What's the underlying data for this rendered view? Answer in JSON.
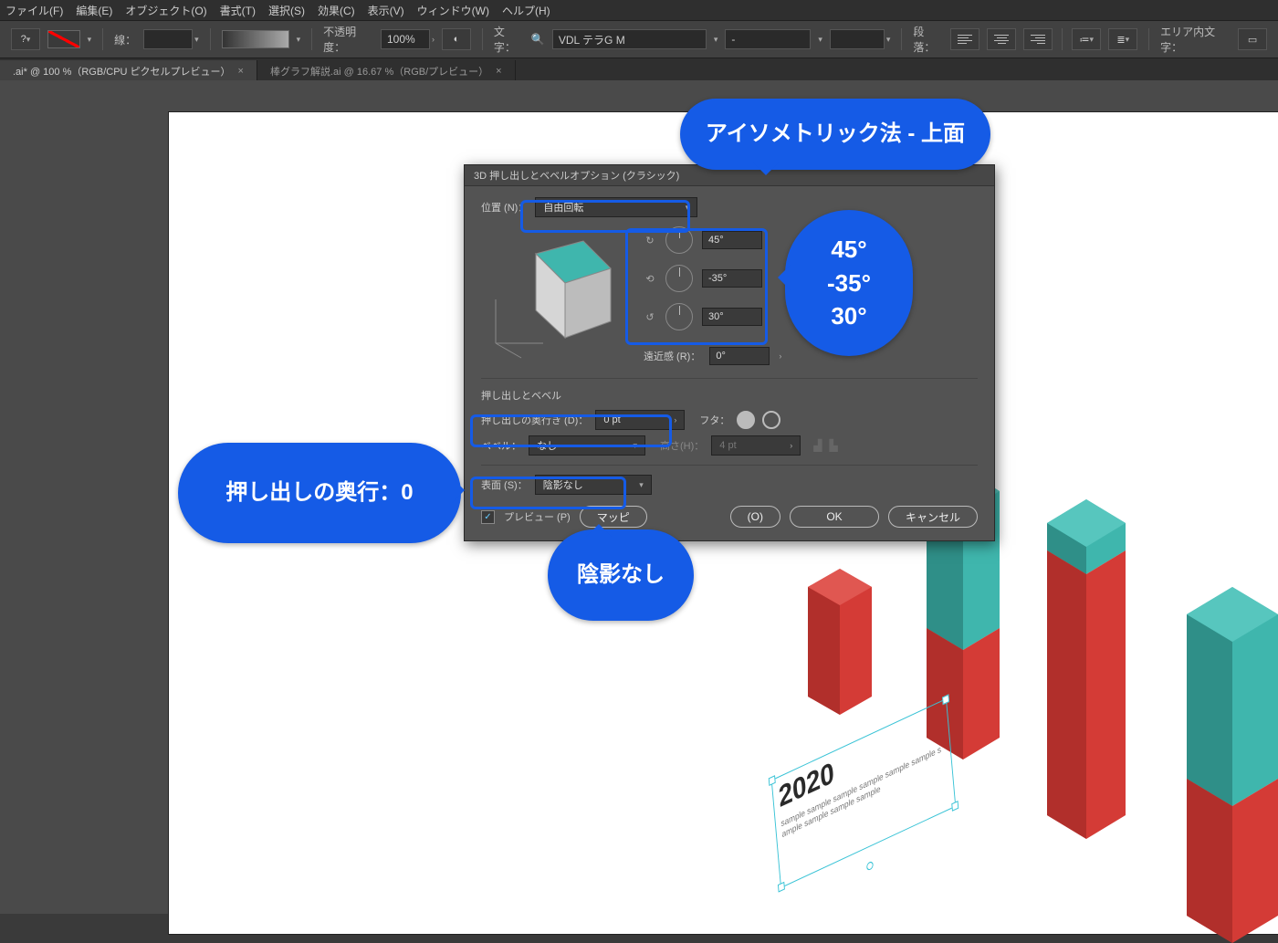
{
  "menu": {
    "items": [
      "ファイル(F)",
      "編集(E)",
      "オブジェクト(O)",
      "書式(T)",
      "選択(S)",
      "効果(C)",
      "表示(V)",
      "ウィンドウ(W)",
      "ヘルプ(H)"
    ]
  },
  "toolbar": {
    "stroke_label": "線：",
    "stroke_pt": "",
    "opacity_label": "不透明度：",
    "opacity_value": "100%",
    "char_label": "文字：",
    "font_value": "VDL テラG M",
    "style_value": "-",
    "size_value": "",
    "para_label": "段落：",
    "area_label": "エリア内文字："
  },
  "tabs": [
    {
      "label": ".ai* @ 100 %（RGB/CPU ピクセルプレビュー）",
      "active": true
    },
    {
      "label": "棒グラフ解説.ai @ 16.67 %（RGB/プレビュー）",
      "active": false
    }
  ],
  "dialog": {
    "title": "3D 押し出しとベベルオプション (クラシック)",
    "position_label": "位置 (N)：",
    "position_value": "自由回転",
    "angles": {
      "x": "45°",
      "y": "-35°",
      "z": "30°"
    },
    "perspective_label": "遠近感 (R)：",
    "perspective_value": "0°",
    "section_extrude": "押し出しとベベル",
    "depth_label": "押し出しの奥行き (D)：",
    "depth_value": "0 pt",
    "cap_label": "フタ：",
    "bevel_label": "ベベル：",
    "bevel_value": "なし",
    "bevelh_label": "高さ(H)：",
    "bevelh_value": "4 pt",
    "surface_label": "表面 (S)：",
    "surface_value": "陰影なし",
    "preview_label": "プレビュー (P)",
    "map_btn": "マッピ",
    "more_opts_suffix": "(O)",
    "ok": "OK",
    "cancel": "キャンセル"
  },
  "callouts": {
    "isometric": "アイソメトリック法 - 上面",
    "angles_lines": [
      "45°",
      "-35°",
      "30°"
    ],
    "depth": "押し出しの奥行：0",
    "shading": "陰影なし"
  },
  "canvas_text": {
    "year": "2020",
    "sample": "sample sample sample sample sample sample sample sample sample sample"
  },
  "colors": {
    "accent": "#155be6",
    "teal": "#3fb6ad",
    "teal_dark": "#2f8f88",
    "red": "#d43b36",
    "red_dark": "#b12f2b"
  }
}
